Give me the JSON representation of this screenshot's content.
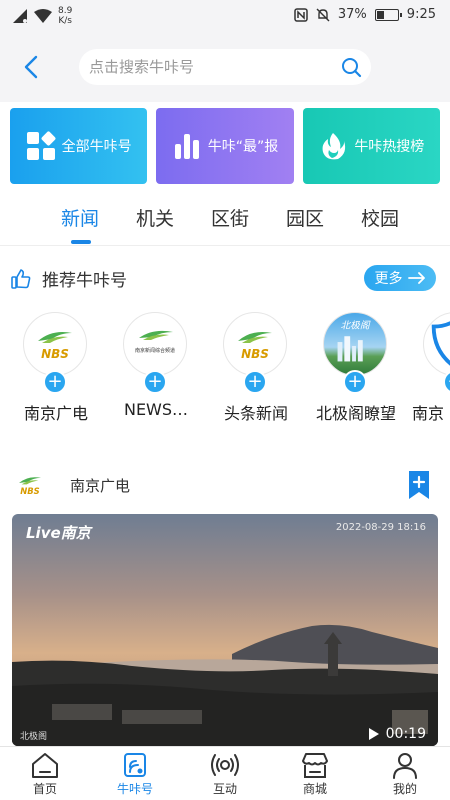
{
  "status_bar": {
    "speed_value": "8.9",
    "speed_unit": "K/s",
    "battery": "37%",
    "battery_level": 0.37,
    "time": "9:25"
  },
  "header": {
    "search_placeholder": "点击搜索牛咔号"
  },
  "cards": [
    {
      "label": "全部牛咔号",
      "icon": "grid-apps-icon"
    },
    {
      "label": "牛咔“最”报",
      "icon": "bar-chart-icon"
    },
    {
      "label": "牛咔热搜榜",
      "icon": "flame-icon"
    }
  ],
  "tabs": [
    {
      "label": "新闻",
      "active": true
    },
    {
      "label": "机关"
    },
    {
      "label": "区街"
    },
    {
      "label": "园区"
    },
    {
      "label": "校园"
    }
  ],
  "recommend": {
    "title": "推荐牛咔号",
    "more_label": "更多"
  },
  "accounts": [
    {
      "name": "南京广电",
      "logo": "NBS"
    },
    {
      "name": "NEWS…",
      "logo": "NBS",
      "logo_caption": "南京新闻综合频道"
    },
    {
      "name": "头条新闻",
      "logo": "NBS"
    },
    {
      "name": "北极阁瞭望",
      "logo": "北极阁"
    },
    {
      "name": "南京"
    }
  ],
  "feed": {
    "source_name": "南京广电",
    "source_logo": "NBS",
    "video": {
      "brand": "Live南京",
      "timestamp": "2022-08-29 18:16",
      "corner": "北极阁",
      "duration": "00:19"
    }
  },
  "bottom_nav": [
    {
      "label": "首页",
      "icon": "home-icon"
    },
    {
      "label": "牛咔号",
      "icon": "niuka-icon",
      "active": true
    },
    {
      "label": "互动",
      "icon": "broadcast-icon"
    },
    {
      "label": "商城",
      "icon": "store-icon"
    },
    {
      "label": "我的",
      "icon": "user-icon"
    }
  ],
  "colors": {
    "accent": "#1a86e6",
    "card1": "#1aa0ee",
    "card2": "#8a74f0",
    "card3": "#20cfbc",
    "plus": "#2aa6f0"
  }
}
